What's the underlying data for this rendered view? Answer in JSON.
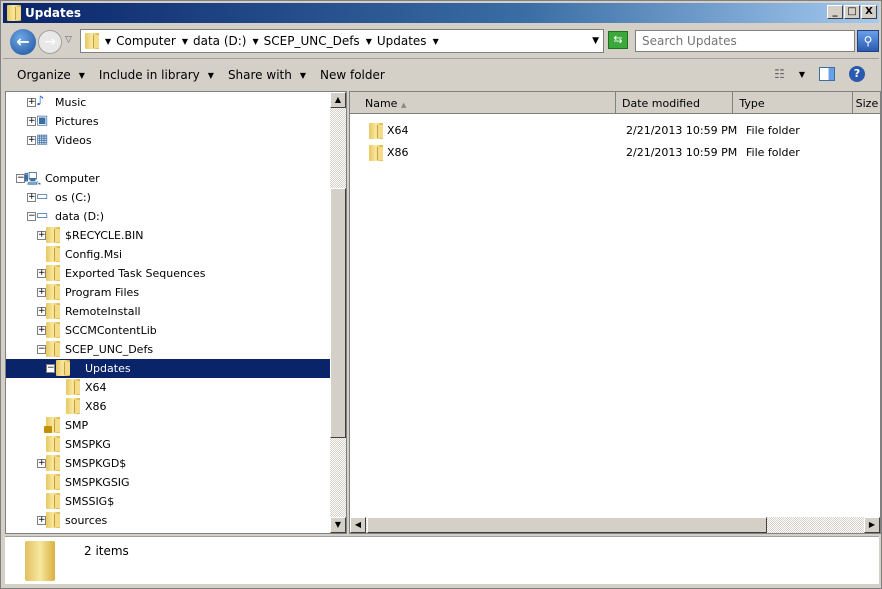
{
  "window": {
    "title": "Updates",
    "controls": [
      "_",
      "□",
      "X"
    ]
  },
  "address": {
    "crumbs": [
      "Computer",
      "data (D:)",
      "SCEP_UNC_Defs",
      "Updates"
    ],
    "search_placeholder": "Search Updates"
  },
  "toolbar": {
    "organize": "Organize",
    "include_in_library": "Include in library",
    "share_with": "Share with",
    "new_folder": "New folder"
  },
  "tree": [
    {
      "label": "Music",
      "level": 1,
      "exp": "+",
      "icon": "music"
    },
    {
      "label": "Pictures",
      "level": 1,
      "exp": "+",
      "icon": "pictures"
    },
    {
      "label": "Videos",
      "level": 1,
      "exp": "+",
      "icon": "videos"
    },
    {
      "label": "",
      "level": 0,
      "exp": "",
      "icon": ""
    },
    {
      "label": "Computer",
      "level": 0,
      "exp": "-",
      "icon": "computer"
    },
    {
      "label": "os (C:)",
      "level": 1,
      "exp": "+",
      "icon": "drive-windows"
    },
    {
      "label": "data (D:)",
      "level": 1,
      "exp": "-",
      "icon": "drive"
    },
    {
      "label": "$RECYCLE.BIN",
      "level": 2,
      "exp": "+",
      "icon": "folder"
    },
    {
      "label": "Config.Msi",
      "level": 2,
      "exp": "",
      "icon": "folder"
    },
    {
      "label": "Exported Task Sequences",
      "level": 2,
      "exp": "+",
      "icon": "folder"
    },
    {
      "label": "Program Files",
      "level": 2,
      "exp": "+",
      "icon": "folder"
    },
    {
      "label": "RemoteInstall",
      "level": 2,
      "exp": "+",
      "icon": "folder"
    },
    {
      "label": "SCCMContentLib",
      "level": 2,
      "exp": "+",
      "icon": "folder"
    },
    {
      "label": "SCEP_UNC_Defs",
      "level": 2,
      "exp": "-",
      "icon": "folder"
    },
    {
      "label": "Updates",
      "level": 3,
      "exp": "-",
      "icon": "folder",
      "selected": true
    },
    {
      "label": "X64",
      "level": 4,
      "exp": "",
      "icon": "folder"
    },
    {
      "label": "X86",
      "level": 4,
      "exp": "",
      "icon": "folder"
    },
    {
      "label": "SMP",
      "level": 2,
      "exp": "",
      "icon": "folder-locked"
    },
    {
      "label": "SMSPKG",
      "level": 2,
      "exp": "",
      "icon": "folder"
    },
    {
      "label": "SMSPKGD$",
      "level": 2,
      "exp": "+",
      "icon": "folder"
    },
    {
      "label": "SMSPKGSIG",
      "level": 2,
      "exp": "",
      "icon": "folder"
    },
    {
      "label": "SMSSIG$",
      "level": 2,
      "exp": "",
      "icon": "folder"
    },
    {
      "label": "sources",
      "level": 2,
      "exp": "+",
      "icon": "folder"
    }
  ],
  "columns": [
    "Name",
    "Date modified",
    "Type",
    "Size"
  ],
  "files": [
    {
      "name": "X64",
      "date": "2/21/2013 10:59 PM",
      "type": "File folder"
    },
    {
      "name": "X86",
      "date": "2/21/2013 10:59 PM",
      "type": "File folder"
    }
  ],
  "status": {
    "count": "2 items"
  },
  "colors": {
    "selection": "#0a246a",
    "title_bar": "#0a246a"
  }
}
